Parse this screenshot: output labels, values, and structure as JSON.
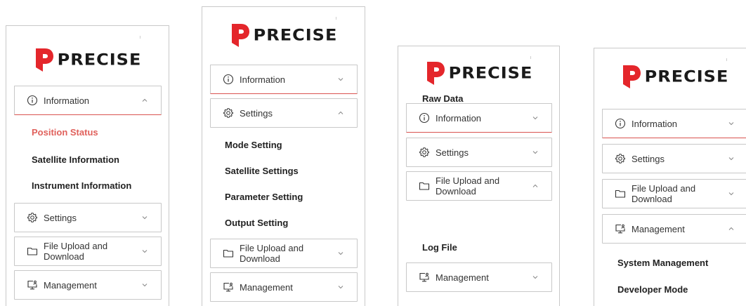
{
  "brand": {
    "name": "PRECISE",
    "color": "#e4262b"
  },
  "menu": {
    "information": "Information",
    "settings": "Settings",
    "file_upload": "File Upload and Download",
    "management": "Management"
  },
  "submenu": {
    "information": [
      "Position Status",
      "Satellite Information",
      "Instrument Information"
    ],
    "settings": [
      "Mode Setting",
      "Satellite Settings",
      "Parameter Setting",
      "Output Setting"
    ],
    "file_upload": [
      "Raw Data",
      "Log File"
    ],
    "management": [
      "System Management",
      "Developer Mode"
    ]
  },
  "icons": {
    "information": "info-circle-icon",
    "settings": "gear-icon",
    "file_upload": "folder-icon",
    "management": "monitor-user-icon",
    "expanded": "chevron-up-icon",
    "collapsed": "chevron-down-icon"
  },
  "colors": {
    "active_item": "#e0605b",
    "open_border": "#d9534f",
    "border": "#c8c8c8"
  }
}
